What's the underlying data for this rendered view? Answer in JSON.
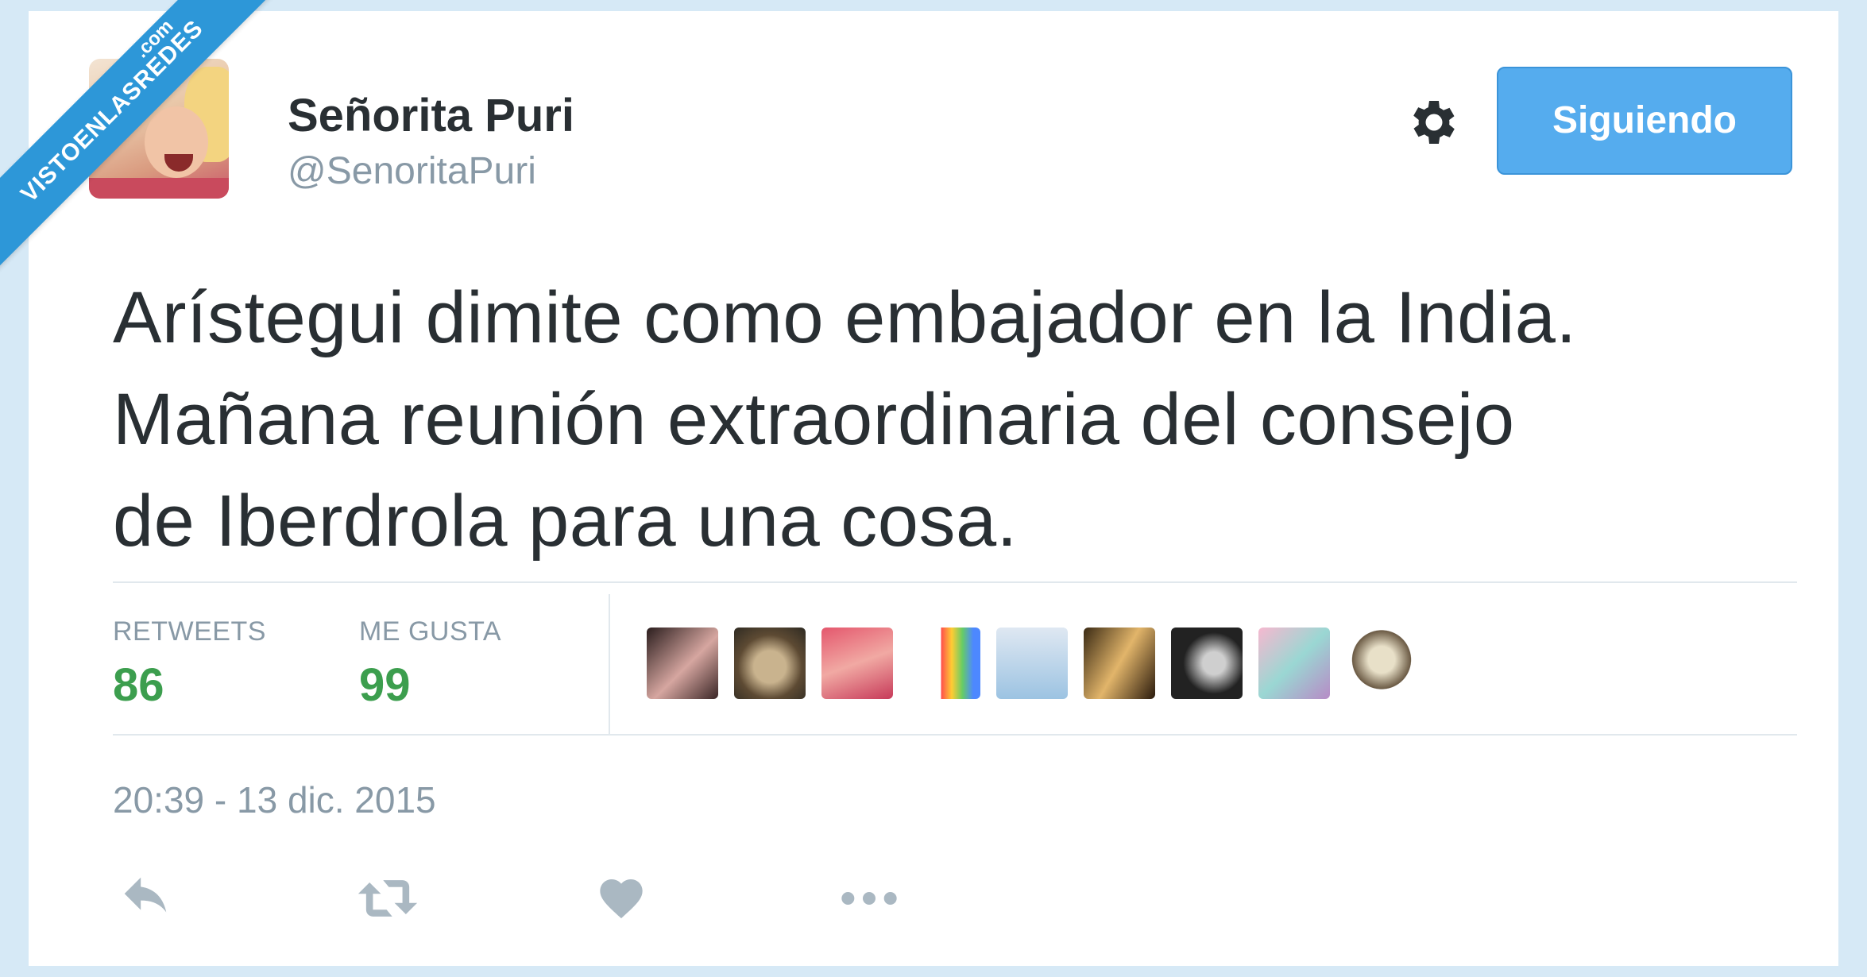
{
  "watermark": {
    "main": "VISTOENLASREDES",
    "sub": ".com"
  },
  "user": {
    "display_name": "Señorita Puri",
    "handle": "@SenoritaPuri"
  },
  "header": {
    "follow_label": "Siguiendo",
    "settings_icon": "gear-icon"
  },
  "tweet": {
    "lines": [
      "Arístegui dimite como embajador en la India.",
      "Mañana reunión extraordinaria del consejo",
      "de Iberdrola para una cosa."
    ]
  },
  "stats": {
    "retweets": {
      "label": "RETWEETS",
      "value": "86"
    },
    "likes": {
      "label": "ME GUSTA",
      "value": "99"
    }
  },
  "likers_count_shown": 9,
  "timestamp": "20:39 - 13 dic. 2015",
  "actions": [
    "reply-icon",
    "retweet-icon",
    "like-icon",
    "more-icon"
  ],
  "colors": {
    "accent": "#55acee",
    "stat_value": "#3c9e4e",
    "muted": "#8899a6",
    "text": "#292f33"
  }
}
